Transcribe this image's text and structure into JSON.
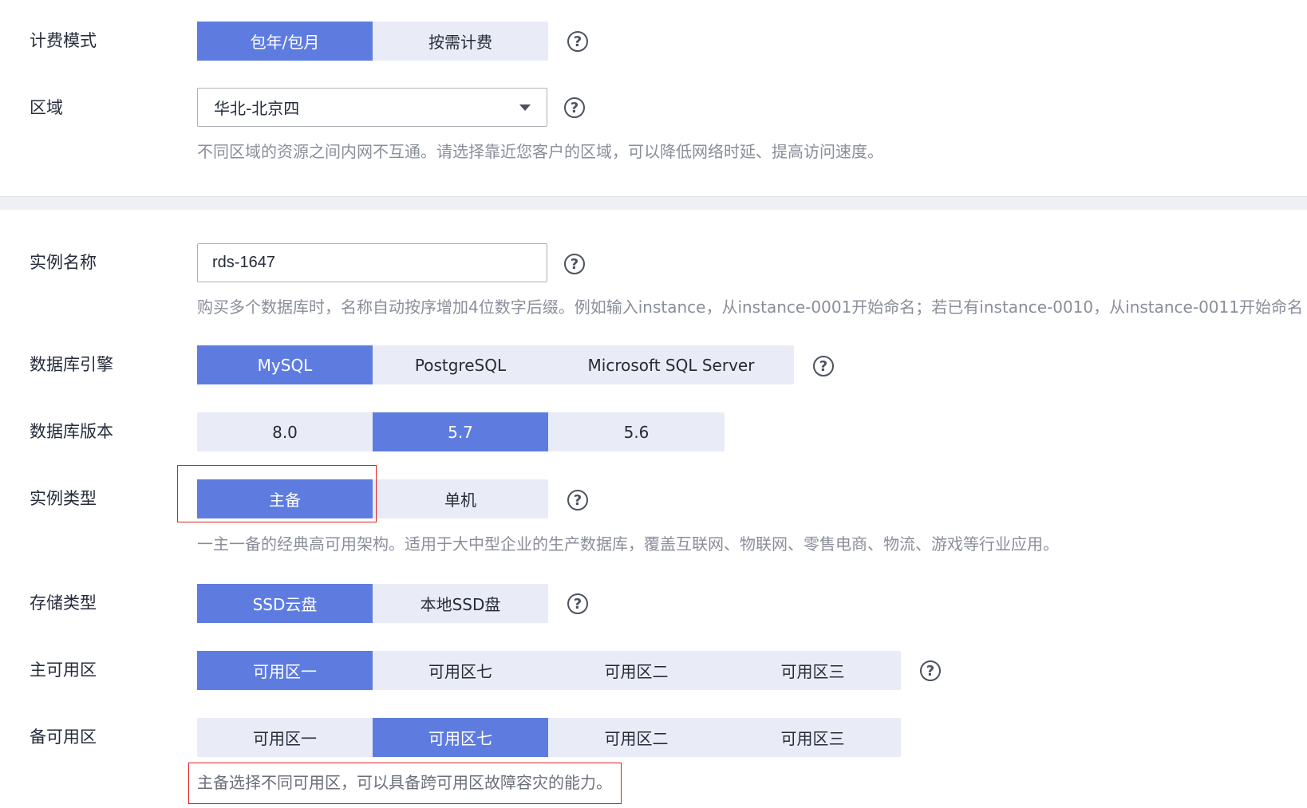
{
  "billing": {
    "label": "计费模式",
    "options": [
      "包年/包月",
      "按需计费"
    ],
    "selected": 0
  },
  "region": {
    "label": "区域",
    "value": "华北-北京四",
    "hint": "不同区域的资源之间内网不互通。请选择靠近您客户的区域，可以降低网络时延、提高访问速度。"
  },
  "instance_name": {
    "label": "实例名称",
    "value": "rds-1647",
    "hint": "购买多个数据库时，名称自动按序增加4位数字后缀。例如输入instance，从instance-0001开始命名；若已有instance-0010，从instance-0011开始命名"
  },
  "engine": {
    "label": "数据库引擎",
    "options": [
      "MySQL",
      "PostgreSQL",
      "Microsoft SQL Server"
    ],
    "selected": 0
  },
  "version": {
    "label": "数据库版本",
    "options": [
      "8.0",
      "5.7",
      "5.6"
    ],
    "selected": 1
  },
  "instance_type": {
    "label": "实例类型",
    "options": [
      "主备",
      "单机"
    ],
    "selected": 0,
    "hint": "一主一备的经典高可用架构。适用于大中型企业的生产数据库，覆盖互联网、物联网、零售电商、物流、游戏等行业应用。"
  },
  "storage": {
    "label": "存储类型",
    "options": [
      "SSD云盘",
      "本地SSD盘"
    ],
    "selected": 0
  },
  "primary_az": {
    "label": "主可用区",
    "options": [
      "可用区一",
      "可用区七",
      "可用区二",
      "可用区三"
    ],
    "selected": 0
  },
  "standby_az": {
    "label": "备可用区",
    "options": [
      "可用区一",
      "可用区七",
      "可用区二",
      "可用区三"
    ],
    "selected": 1,
    "hint": "主备选择不同可用区，可以具备跨可用区故障容灾的能力。"
  },
  "help_glyph": "?",
  "colors": {
    "accent": "#5e7ce0",
    "segment_bg": "#e9ecf7",
    "hint_text": "#8a8e99",
    "highlight_box": "#e02020"
  },
  "icons": {
    "help": "help-circle-icon",
    "dropdown": "chevron-down-icon"
  }
}
